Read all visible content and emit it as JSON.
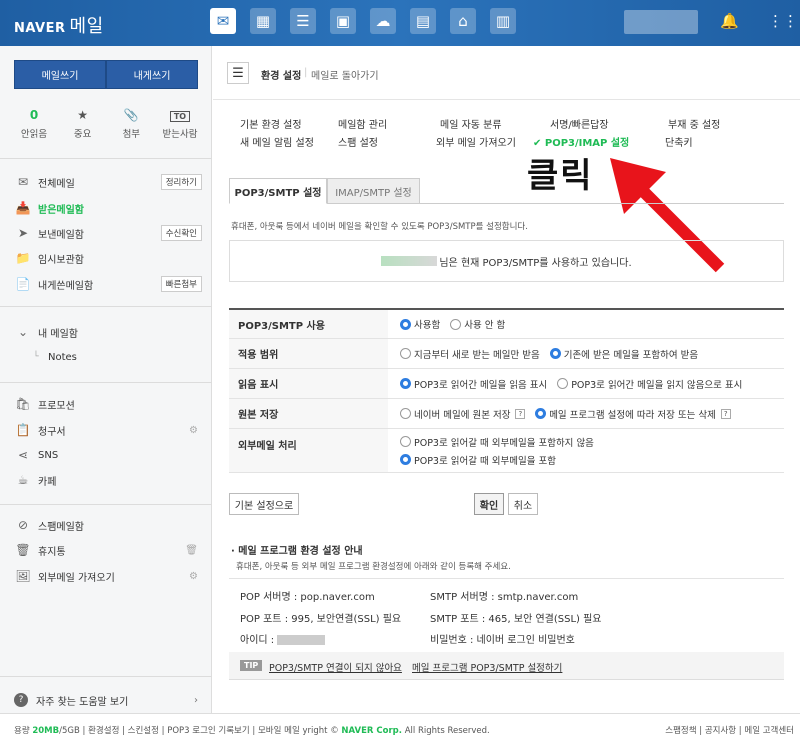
{
  "brand": {
    "naver": "NAVER",
    "mail": "메일"
  },
  "compose": {
    "write": "메일쓰기",
    "to_me": "내게쓰기"
  },
  "quick": [
    {
      "top": "0",
      "label": "안읽음"
    },
    {
      "top": "★",
      "label": "중요"
    },
    {
      "top": "📎",
      "label": "첨부"
    },
    {
      "top": "TO",
      "label": "받는사람"
    }
  ],
  "folders": [
    {
      "label": "전체메일",
      "icon": "✉",
      "tag": "정리하기"
    },
    {
      "label": "받은메일함",
      "icon": "📥",
      "tag": ""
    },
    {
      "label": "보낸메일함",
      "icon": "➤",
      "tag": "수신확인"
    },
    {
      "label": "임시보관함",
      "icon": "📁",
      "tag": ""
    },
    {
      "label": "내게쓴메일함",
      "icon": "📄",
      "tag": "빠른첨부"
    }
  ],
  "my_mailbox": {
    "title": "내 메일함",
    "notes": "Notes"
  },
  "extras": [
    {
      "label": "프로모션",
      "icon": "🛍"
    },
    {
      "label": "청구서",
      "icon": "📋"
    },
    {
      "label": "SNS",
      "icon": "⋖"
    },
    {
      "label": "카페",
      "icon": "☕"
    }
  ],
  "system": [
    {
      "label": "스팸메일함",
      "icon": "⊘"
    },
    {
      "label": "휴지통",
      "icon": "🗑"
    },
    {
      "label": "외부메일 가져오기",
      "icon": "🖼"
    }
  ],
  "help": "자주 찾는 도움말 보기",
  "header": {
    "title": "환경 설정",
    "back": "메일로 돌아가기"
  },
  "settings_menu": [
    "기본 환경 설정",
    "메일함 관리",
    "메일 자동 분류",
    "서명/빠른답장",
    "부재 중 설정",
    "새 메일 알림 설정",
    "스팸 설정",
    "외부 메일 가져오기",
    "✔ POP3/IMAP 설정",
    "단축키"
  ],
  "annotation": "클릭",
  "tabs": {
    "pop": "POP3/SMTP 설정",
    "imap": "IMAP/SMTP 설정"
  },
  "desc": "휴대폰, 아웃룩 등에서 네이버 메일을 확인할 수 있도록 POP3/SMTP를 설정합니다.",
  "status": "님은 현재 POP3/SMTP를 사용하고 있습니다.",
  "rows": [
    {
      "th": "POP3/SMTP 사용",
      "opts": [
        {
          "t": "사용함",
          "on": true
        },
        {
          "t": "사용 안 함",
          "on": false
        }
      ]
    },
    {
      "th": "적용 범위",
      "opts": [
        {
          "t": "지금부터 새로 받는 메일만 받음",
          "on": false
        },
        {
          "t": "기존에 받은 메일을 포함하여 받음",
          "on": true
        }
      ]
    },
    {
      "th": "읽음 표시",
      "opts": [
        {
          "t": "POP3로 읽어간 메일을 읽음 표시",
          "on": true
        },
        {
          "t": "POP3로 읽어간 메일을 읽지 않음으로 표시",
          "on": false
        }
      ]
    },
    {
      "th": "원본 저장",
      "opts": [
        {
          "t": "네이버 메일에 원본 저장",
          "on": false
        },
        {
          "t": "메일 프로그램 설정에 따라 저장 또는 삭제",
          "on": true
        }
      ]
    },
    {
      "th": "외부메일 처리",
      "opts": [
        {
          "t": "POP3로 읽어갈 때 외부메일을 포함하지 않음",
          "on": false
        },
        {
          "t": "POP3로 읽어갈 때 외부메일을 포함",
          "on": true
        }
      ]
    }
  ],
  "buttons": {
    "reset": "기본 설정으로",
    "ok": "확인",
    "cancel": "취소"
  },
  "guide": {
    "title": "메일 프로그램 환경 설정 안내",
    "desc": "휴대폰, 아웃룩 등 외부 메일 프로그램 환경설정에 아래와 같이 등록해 주세요.",
    "pop_server": "POP 서버명 : pop.naver.com",
    "smtp_server": "SMTP 서버명 : smtp.naver.com",
    "pop_port": "POP 포트 : 995, 보안연결(SSL) 필요",
    "smtp_port": "SMTP 포트 : 465, 보안 연결(SSL) 필요",
    "id": "아이디 :",
    "pw": "비밀번호 : 네이버 로그인 비밀번호"
  },
  "tip": {
    "label": "TIP",
    "link1": "POP3/SMTP 연결이 되지 않아요",
    "link2": "메일 프로그램 POP3/SMTP 설정하기"
  },
  "footer": {
    "usage_label": "용량",
    "usage": "20MB",
    "total": "/5GB",
    "links": "환경설정 | 스킨설정 | POP3 로그인 기록보기 | 모바일 메일",
    "copy": "yright ©",
    "corp": "NAVER Corp.",
    "rights": "All Rights Reserved.",
    "right": "스팸정책 | 공지사항 | 메일 고객센터"
  }
}
